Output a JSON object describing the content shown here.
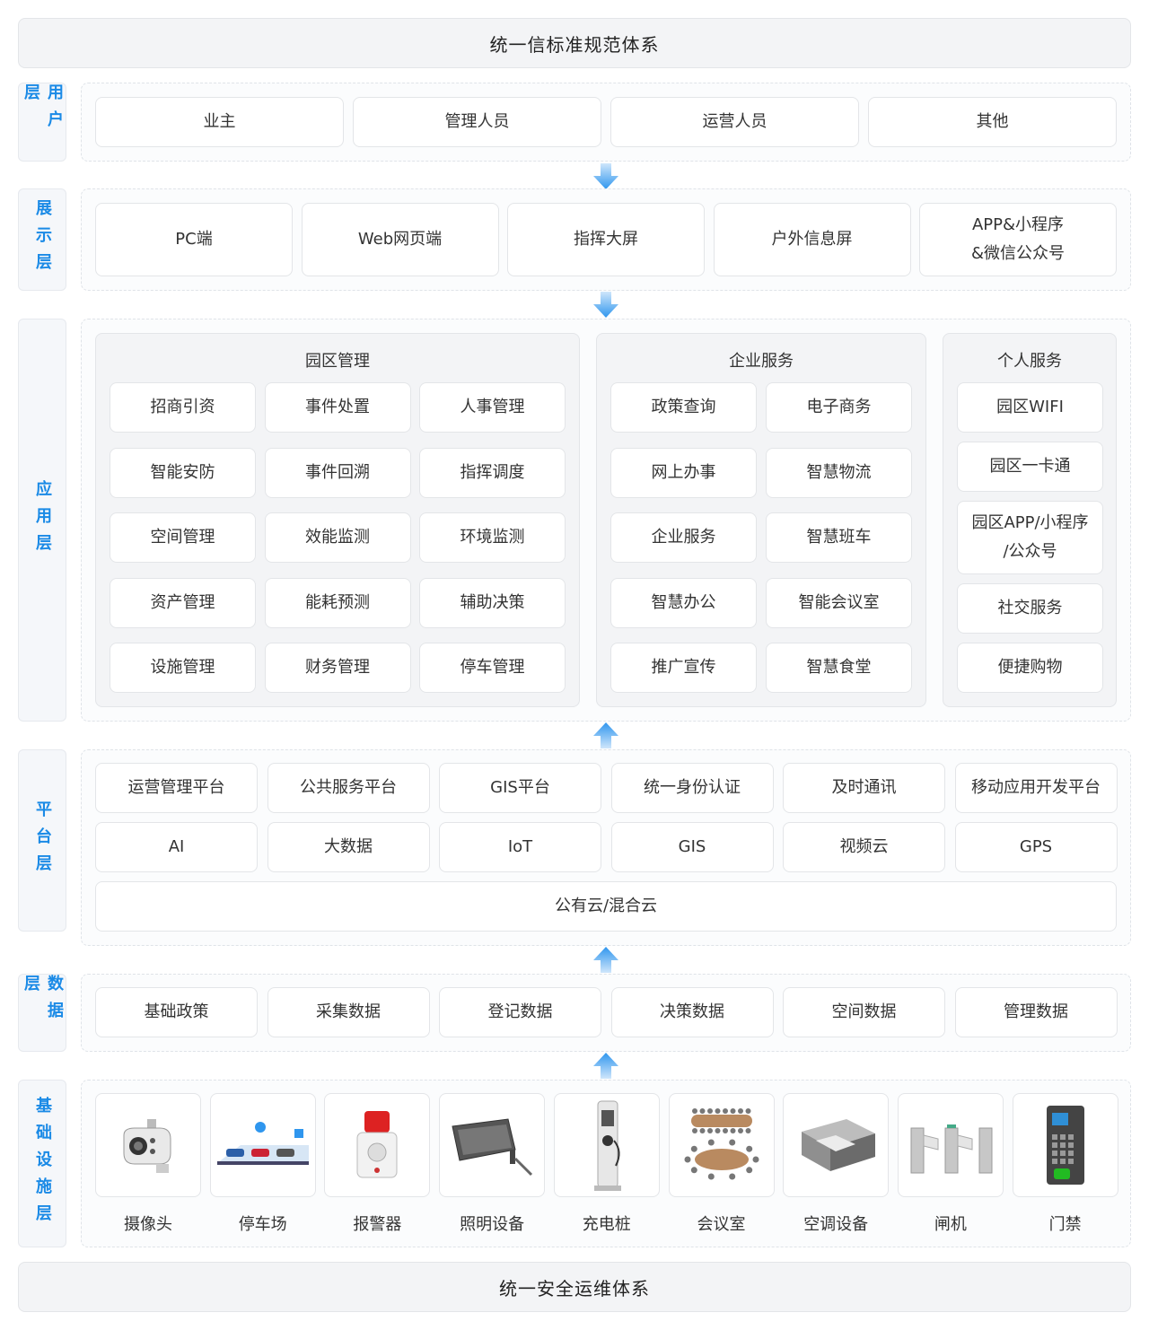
{
  "top_bar": "统一信标准规范体系",
  "bottom_bar": "统一安全运维体系",
  "layers": {
    "user": "用户层",
    "display": "展示层",
    "app": "应用层",
    "platform": "平台层",
    "data": "数据层",
    "infra": "基础设施层"
  },
  "user_items": [
    "业主",
    "管理人员",
    "运营人员",
    "其他"
  ],
  "display_items": [
    "PC端",
    "Web网页端",
    "指挥大屏",
    "户外信息屏",
    "APP&小程序\n&微信公众号"
  ],
  "park": {
    "title": "园区管理",
    "items": [
      "招商引资",
      "事件处置",
      "人事管理",
      "智能安防",
      "事件回溯",
      "指挥调度",
      "空间管理",
      "效能监测",
      "环境监测",
      "资产管理",
      "能耗预测",
      "辅助决策",
      "设施管理",
      "财务管理",
      "停车管理"
    ]
  },
  "enterprise": {
    "title": "企业服务",
    "items": [
      "政策查询",
      "电子商务",
      "网上办事",
      "智慧物流",
      "企业服务",
      "智慧班车",
      "智慧办公",
      "智能会议室",
      "推广宣传",
      "智慧食堂"
    ]
  },
  "personal": {
    "title": "个人服务",
    "items": [
      "园区WIFI",
      "园区一卡通",
      "园区APP/小程序\n/公众号",
      "社交服务",
      "便捷购物"
    ]
  },
  "platform_row1": [
    "运营管理平台",
    "公共服务平台",
    "GIS平台",
    "统一身份认证",
    "及时通讯",
    "移动应用开发平台"
  ],
  "platform_row2": [
    "AI",
    "大数据",
    "IoT",
    "GIS",
    "视频云",
    "GPS"
  ],
  "platform_cloud": "公有云/混合云",
  "data_items": [
    "基础政策",
    "采集数据",
    "登记数据",
    "决策数据",
    "空间数据",
    "管理数据"
  ],
  "devices": [
    {
      "label": "摄像头",
      "icon": "camera-icon"
    },
    {
      "label": "停车场",
      "icon": "parking-icon"
    },
    {
      "label": "报警器",
      "icon": "alarm-icon"
    },
    {
      "label": "照明设备",
      "icon": "light-icon"
    },
    {
      "label": "充电桩",
      "icon": "charger-icon"
    },
    {
      "label": "会议室",
      "icon": "meeting-room-icon"
    },
    {
      "label": "空调设备",
      "icon": "air-conditioner-icon"
    },
    {
      "label": "闸机",
      "icon": "turnstile-icon"
    },
    {
      "label": "门禁",
      "icon": "access-control-icon"
    }
  ],
  "colors": {
    "accent": "#1a8ae6",
    "arrow": "#4aa8f0"
  }
}
